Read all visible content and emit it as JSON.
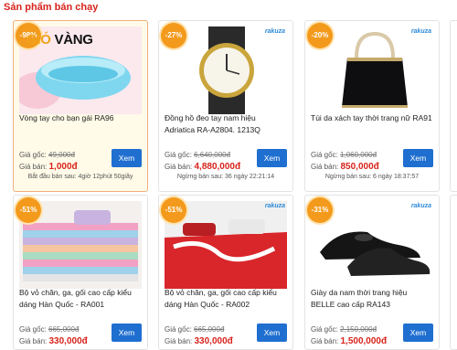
{
  "section": {
    "title": "Sản phẩm bán chạy"
  },
  "logo": {
    "text_1": "GIÓ",
    "text_2": "VÀNG"
  },
  "labels": {
    "price_orig": "Giá gốc:",
    "price_sale": "Giá bán:",
    "buy": "Xem"
  },
  "products": [
    {
      "discount": "-98%",
      "brand": "",
      "name": "Vòng tay cho bạn gái RA96",
      "price_orig": "49,000đ",
      "price_sale": "1,000đ",
      "footer": "Bắt đầu bán sau: 4giờ 12phút 50giây"
    },
    {
      "discount": "-27%",
      "brand": "rakuza",
      "name": "Đồng hồ đeo tay nam hiệu Adriatica RA-A2804. 1213Q",
      "price_orig": "6,640,000đ",
      "price_sale": "4,880,000đ",
      "footer": "Ngừng bán sau: 36 ngày 22:21:14"
    },
    {
      "discount": "-20%",
      "brand": "rakuza",
      "name": "Túi da xách tay thời trang nữ RA91",
      "price_orig": "1,060,000đ",
      "price_sale": "850,000đ",
      "footer": "Ngừng bán sau: 6 ngày 18:37:57"
    },
    {
      "discount": "-51%",
      "brand": "",
      "name": "Bộ vỏ chăn, ga, gối cao cấp kiểu dáng Hàn Quốc - RA001",
      "price_orig": "665,000đ",
      "price_sale": "330,000đ",
      "footer": ""
    },
    {
      "discount": "-51%",
      "brand": "rakuza",
      "name": "Bộ vỏ chăn, ga, gối cao cấp kiểu dáng Hàn Quốc - RA002",
      "price_orig": "665,000đ",
      "price_sale": "330,000đ",
      "footer": ""
    },
    {
      "discount": "-31%",
      "brand": "rakuza",
      "name": "Giày da nam thời trang hiệu BELLE cao cấp RA143",
      "price_orig": "2,150,000đ",
      "price_sale": "1,500,000đ",
      "footer": ""
    }
  ]
}
